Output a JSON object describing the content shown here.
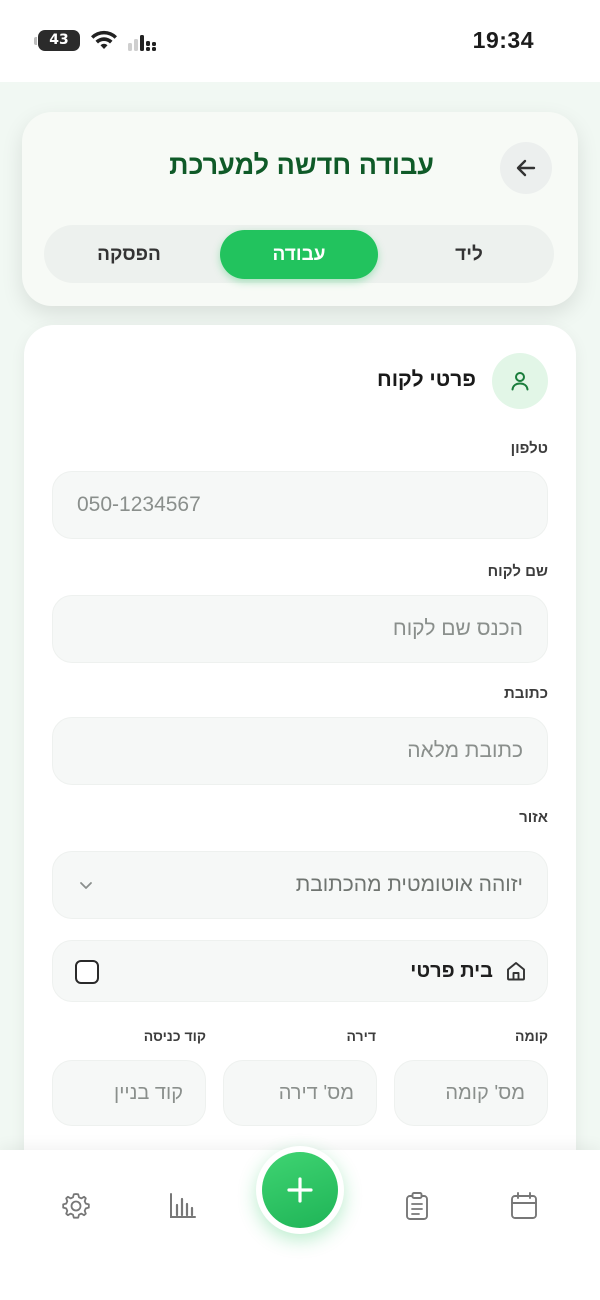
{
  "status_bar": {
    "time": "19:34",
    "battery": "43"
  },
  "header": {
    "title": "עבודה חדשה למערכת",
    "tabs": [
      "ליד",
      "עבודה",
      "הפסקה"
    ],
    "active_tab": "עבודה"
  },
  "form": {
    "section_title": "פרטי לקוח",
    "phone": {
      "label": "טלפון",
      "placeholder": "050-1234567"
    },
    "customer_name": {
      "label": "שם לקוח",
      "placeholder": "הכנס שם לקוח"
    },
    "address": {
      "label": "כתובת",
      "placeholder": "כתובת מלאה"
    },
    "area": {
      "label": "אזור",
      "value": "יזוהה אוטומטית מהכתובת"
    },
    "private_house": {
      "label": "בית פרטי",
      "checked": false
    },
    "floor": {
      "label": "קומה",
      "placeholder": "מס' קומה"
    },
    "apartment": {
      "label": "דירה",
      "placeholder": "מס' דירה"
    },
    "entry_code": {
      "label": "קוד כניסה",
      "placeholder": "קוד בניין"
    }
  },
  "bottom_nav": {
    "items": [
      "calendar-icon",
      "clipboard-icon",
      "add-icon",
      "chart-icon",
      "settings-icon"
    ]
  },
  "colors": {
    "accent": "#22c35e",
    "title_green": "#0f5a28",
    "background": "#f1f8f3"
  }
}
